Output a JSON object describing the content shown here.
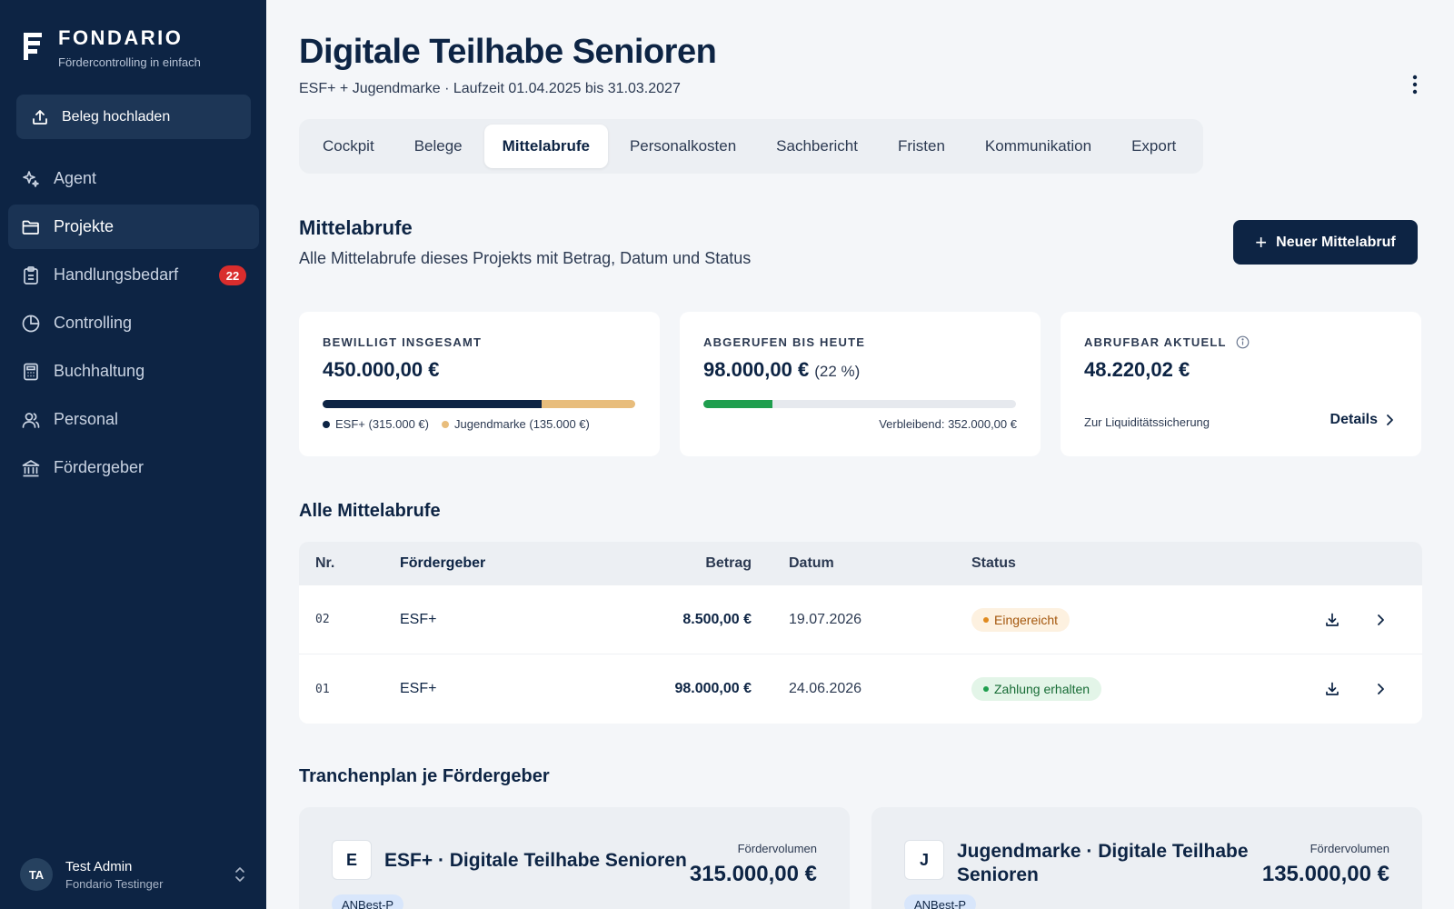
{
  "brand": {
    "name": "FONDARIO",
    "tagline": "Fördercontrolling in einfach"
  },
  "sidebar": {
    "upload_label": "Beleg hochladen",
    "items": [
      {
        "label": "Agent",
        "icon": "sparkle-icon"
      },
      {
        "label": "Projekte",
        "icon": "folder-icon",
        "active": true
      },
      {
        "label": "Handlungsbedarf",
        "icon": "clipboard-icon",
        "badge": "22"
      },
      {
        "label": "Controlling",
        "icon": "pie-chart-icon"
      },
      {
        "label": "Buchhaltung",
        "icon": "calculator-icon"
      },
      {
        "label": "Personal",
        "icon": "users-icon"
      },
      {
        "label": "Fördergeber",
        "icon": "bank-icon"
      }
    ],
    "user": {
      "initials": "TA",
      "name": "Test Admin",
      "org": "Fondario Testinger"
    }
  },
  "header": {
    "title": "Digitale Teilhabe Senioren",
    "subtitle": "ESF+ + Jugendmarke · Laufzeit 01.04.2025 bis 31.03.2027"
  },
  "tabs": [
    {
      "label": "Cockpit"
    },
    {
      "label": "Belege"
    },
    {
      "label": "Mittelabrufe",
      "active": true
    },
    {
      "label": "Personalkosten"
    },
    {
      "label": "Sachbericht"
    },
    {
      "label": "Fristen"
    },
    {
      "label": "Kommunikation"
    },
    {
      "label": "Export"
    }
  ],
  "section": {
    "title": "Mittelabrufe",
    "subtitle": "Alle Mittelabrufe dieses Projekts mit Betrag, Datum und Status",
    "new_button": "Neuer Mittelabruf"
  },
  "cards": {
    "approved": {
      "label": "BEWILLIGT INSGESAMT",
      "value": "450.000,00 €",
      "split": [
        {
          "label": "ESF+ (315.000 €)",
          "fraction": 0.7,
          "color": "#0d2444"
        },
        {
          "label": "Jugendmarke (135.000 €)",
          "fraction": 0.3,
          "color": "#e8bd7c"
        }
      ]
    },
    "called": {
      "label": "ABGERUFEN BIS HEUTE",
      "value": "98.000,00 €",
      "percent_label": "(22 %)",
      "progress": 0.22,
      "bar_color": "#1f9e4e",
      "remaining": "Verbleibend: 352.000,00 €"
    },
    "available": {
      "label": "ABRUFBAR AKTUELL",
      "value": "48.220,02 €",
      "note": "Zur Liquiditätssicherung",
      "details_label": "Details"
    }
  },
  "table": {
    "title": "Alle Mittelabrufe",
    "headers": {
      "nr": "Nr.",
      "funder": "Fördergeber",
      "amount": "Betrag",
      "date": "Datum",
      "status": "Status"
    },
    "rows": [
      {
        "nr": "02",
        "funder": "ESF+",
        "amount": "8.500,00 €",
        "date": "19.07.2026",
        "status": "Eingereicht",
        "status_bg": "#fdf1e0",
        "status_fg": "#a4570d",
        "status_dot": "#e08a1e"
      },
      {
        "nr": "01",
        "funder": "ESF+",
        "amount": "98.000,00 €",
        "date": "24.06.2026",
        "status": "Zahlung erhalten",
        "status_bg": "#e3f5e8",
        "status_fg": "#166b34",
        "status_dot": "#1f9e4e"
      }
    ]
  },
  "tranches": {
    "title": "Tranchenplan je Fördergeber",
    "items": [
      {
        "letter": "E",
        "name": "ESF+ · Digitale Teilhabe Senioren",
        "volume_label": "Fördervolumen",
        "volume": "315.000,00 €",
        "tag": "ANBest-P"
      },
      {
        "letter": "J",
        "name": "Jugendmarke · Digitale Teilhabe Senioren",
        "volume_label": "Fördervolumen",
        "volume": "135.000,00 €",
        "tag": "ANBest-P"
      }
    ]
  },
  "colors": {
    "sidebar": "#0d2444",
    "accent": "#0d2444",
    "danger": "#d92d2d"
  }
}
